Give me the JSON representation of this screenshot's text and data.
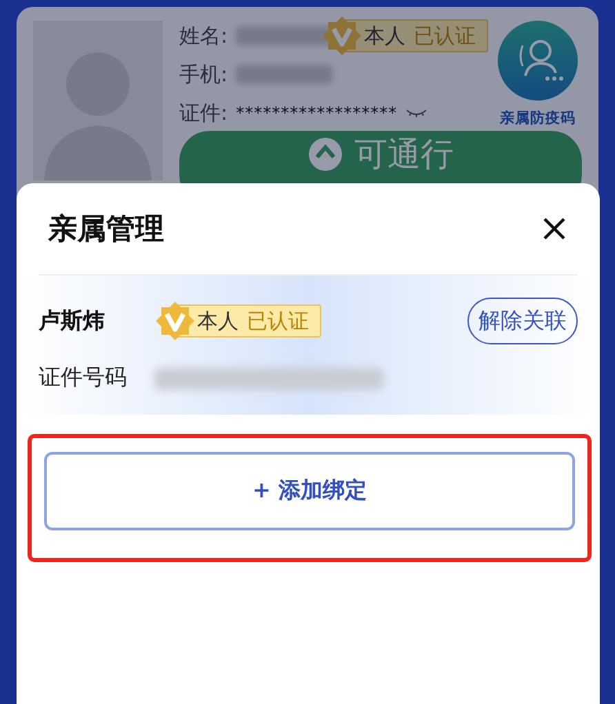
{
  "background_card": {
    "fields": [
      {
        "label": "姓名:",
        "kind": "redacted",
        "badge": {
          "role": "本人",
          "status": "已认证"
        }
      },
      {
        "label": "手机:",
        "kind": "redacted"
      },
      {
        "label": "证件:",
        "kind": "masked",
        "value": "******************"
      }
    ],
    "shortcut": {
      "label": "亲属防疫码"
    },
    "pass_button": {
      "label": "可通行"
    }
  },
  "dialog": {
    "title": "亲属管理",
    "members": [
      {
        "name": "卢斯炜",
        "badge": {
          "role": "本人",
          "status": "已认证"
        },
        "unlink_button": "解除关联",
        "id_label": "证件号码"
      }
    ],
    "add_button": {
      "label": "+ 添加绑定",
      "highlighted": true
    }
  }
}
